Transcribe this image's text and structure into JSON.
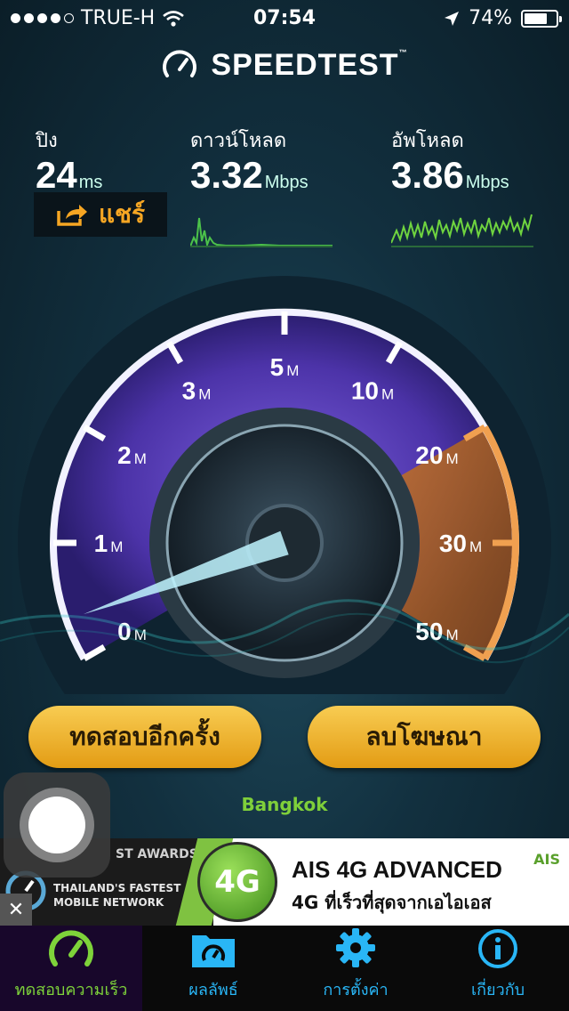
{
  "status_bar": {
    "carrier": "TRUE-H",
    "time": "07:54",
    "battery": "74%",
    "battery_level": 0.74
  },
  "header": {
    "title": "SPEEDTEST",
    "trademark": "™"
  },
  "metrics": {
    "ping": {
      "label": "ปิง",
      "value": "24",
      "unit": "ms"
    },
    "download": {
      "label": "ดาวน์โหลด",
      "value": "3.32",
      "unit": "Mbps"
    },
    "upload": {
      "label": "อัพโหลด",
      "value": "3.86",
      "unit": "Mbps"
    }
  },
  "share_button": "แชร์",
  "gauge": {
    "ticks": [
      {
        "label": "0",
        "unit": "M"
      },
      {
        "label": "1",
        "unit": "M"
      },
      {
        "label": "2",
        "unit": "M"
      },
      {
        "label": "3",
        "unit": "M"
      },
      {
        "label": "5",
        "unit": "M"
      },
      {
        "label": "10",
        "unit": "M"
      },
      {
        "label": "20",
        "unit": "M"
      },
      {
        "label": "30",
        "unit": "M"
      },
      {
        "label": "50",
        "unit": "M"
      }
    ],
    "needle_value_mbps": 0.35,
    "colors": {
      "low_arc": "#6a4fc9",
      "high_arc": "#e08a2a"
    }
  },
  "buttons": {
    "test_again": "ทดสอบอีกครั้ง",
    "remove_ads": "ลบโฆษณา"
  },
  "location": "Bangkok",
  "ad": {
    "award_text": "ST AWARDS",
    "fastest_line1": "THAILAND'S FASTEST",
    "fastest_line2": "MOBILE NETWORK",
    "badge": "4G",
    "title": "AIS 4G ADVANCED",
    "subtitle": "4G ที่เร็วที่สุดจากเอไอเอส",
    "brand": "AIS",
    "close": "✕"
  },
  "tabs": [
    {
      "label": "ทดสอบความเร็ว",
      "icon": "speedometer-icon",
      "active": true
    },
    {
      "label": "ผลลัพธ์",
      "icon": "folder-speedometer-icon",
      "active": false
    },
    {
      "label": "การตั้งค่า",
      "icon": "gear-icon",
      "active": false
    },
    {
      "label": "เกี่ยวกับ",
      "icon": "info-icon",
      "active": false
    }
  ],
  "accent_colors": {
    "green": "#7ed33a",
    "blue": "#29b6f6",
    "orange": "#f6a623"
  }
}
